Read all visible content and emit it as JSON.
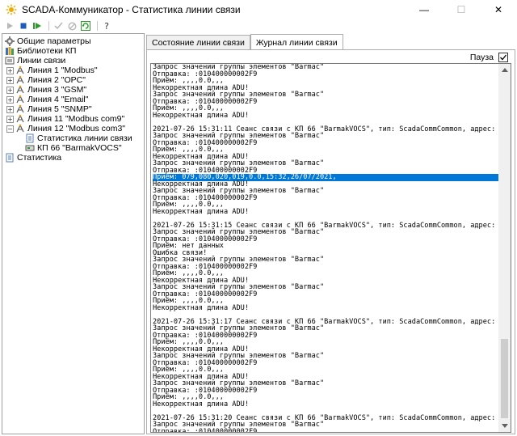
{
  "window": {
    "title": "SCADA-Коммуникатор - Статистика линии связи",
    "minimize": "—",
    "maximize": "☐",
    "close": "✕"
  },
  "colors": {
    "selection": "#0078d7",
    "accent_green": "#2e9a2e",
    "accent_blue": "#1e5bbf"
  },
  "toolbar": [
    "start-icon",
    "stop-icon",
    "restart-icon",
    "apply-icon",
    "cancel-icon",
    "refresh-icon",
    "help-icon"
  ],
  "tree": {
    "items": [
      {
        "label": "Общие параметры",
        "icon": "settings-icon",
        "level": 0,
        "expander": ""
      },
      {
        "label": "Библиотеки КП",
        "icon": "library-icon",
        "level": 0,
        "expander": ""
      },
      {
        "label": "Линии связи",
        "icon": "lines-icon",
        "level": 0,
        "expander": ""
      },
      {
        "label": "Линия 1 \"Modbus\"",
        "icon": "line-icon",
        "level": 1,
        "expander": "+"
      },
      {
        "label": "Линия 2 \"OPC\"",
        "icon": "line-icon",
        "level": 1,
        "expander": "+"
      },
      {
        "label": "Линия 3 \"GSM\"",
        "icon": "line-icon",
        "level": 1,
        "expander": "+"
      },
      {
        "label": "Линия 4 \"Email\"",
        "icon": "line-icon",
        "level": 1,
        "expander": "+"
      },
      {
        "label": "Линия 5 \"SNMP\"",
        "icon": "line-icon",
        "level": 1,
        "expander": "+"
      },
      {
        "label": "Линия 11 \"Modbus com9\"",
        "icon": "line-icon",
        "level": 1,
        "expander": "+"
      },
      {
        "label": "Линия 12 \"Modbus com3\"",
        "icon": "line-icon",
        "level": 1,
        "expander": "−"
      },
      {
        "label": "Статистика линии связи",
        "icon": "stats-doc-icon",
        "level": 2,
        "expander": ""
      },
      {
        "label": "КП 66 \"BarmakVOCS\"",
        "icon": "device-icon",
        "level": 2,
        "expander": ""
      },
      {
        "label": "Статистика",
        "icon": "stats-doc-icon",
        "level": 0,
        "expander": ""
      }
    ]
  },
  "tabs": [
    {
      "label": "Состояние линии связи",
      "active": false
    },
    {
      "label": "Журнал линии связи",
      "active": true
    }
  ],
  "pause_label": "Пауза",
  "pause_checked": true,
  "log_lines": [
    "Запрос значений группы элементов \"Barmac\"",
    "Отправка: :010400000002F9",
    "Приём: ,,,,0.0,,,",
    "Некорректная длина ADU!",
    "Запрос значений группы элементов \"Barmac\"",
    "Отправка: :010400000002F9",
    "Приём: ,,,,0.0,,,",
    "Некорректная длина ADU!",
    "",
    "2021-07-26 15:31:11 Сеанс связи с КП 66 \"BarmakVOCS\", тип: ScadaCommCommon, адрес:",
    "Запрос значений группы элементов \"Barmac\"",
    "Отправка: :010400000002F9",
    "Приём: ,,,,0.0,,,",
    "Некорректная длина ADU!",
    "Запрос значений группы элементов \"Barmac\"",
    "Отправка: :010400000002F9",
    "Приём: 079,080,020,019,0.0,15:32,26/07/2021,",
    "Некорректная длина ADU!",
    "Запрос значений группы элементов \"Barmac\"",
    "Отправка: :010400000002F9",
    "Приём: ,,,,0.0,,,",
    "Некорректная длина ADU!",
    "",
    "2021-07-26 15:31:15 Сеанс связи с КП 66 \"BarmakVOCS\", тип: ScadaCommCommon, адрес:",
    "Запрос значений группы элементов \"Barmac\"",
    "Отправка: :010400000002F9",
    "Приём: нет данных",
    "Ошибка связи!",
    "Запрос значений группы элементов \"Barmac\"",
    "Отправка: :010400000002F9",
    "Приём: ,,,,0.0,,,",
    "Некорректная длина ADU!",
    "Запрос значений группы элементов \"Barmac\"",
    "Отправка: :010400000002F9",
    "Приём: ,,,,0.0,,,",
    "Некорректная длина ADU!",
    "",
    "2021-07-26 15:31:17 Сеанс связи с КП 66 \"BarmakVOCS\", тип: ScadaCommCommon, адрес:",
    "Запрос значений группы элементов \"Barmac\"",
    "Отправка: :010400000002F9",
    "Приём: ,,,,0.0,,,",
    "Некорректная длина ADU!",
    "Запрос значений группы элементов \"Barmac\"",
    "Отправка: :010400000002F9",
    "Приём: ,,,,0.0,,,",
    "Некорректная длина ADU!",
    "Запрос значений группы элементов \"Barmac\"",
    "Отправка: :010400000002F9",
    "Приём: ,,,,0.0,,,",
    "Некорректная длина ADU!",
    "",
    "2021-07-26 15:31:20 Сеанс связи с КП 66 \"BarmakVOCS\", тип: ScadaCommCommon, адрес:",
    "Запрос значений группы элементов \"Barmac\"",
    "Отправка: :010400000002F9"
  ],
  "highlighted_line_index": 16
}
